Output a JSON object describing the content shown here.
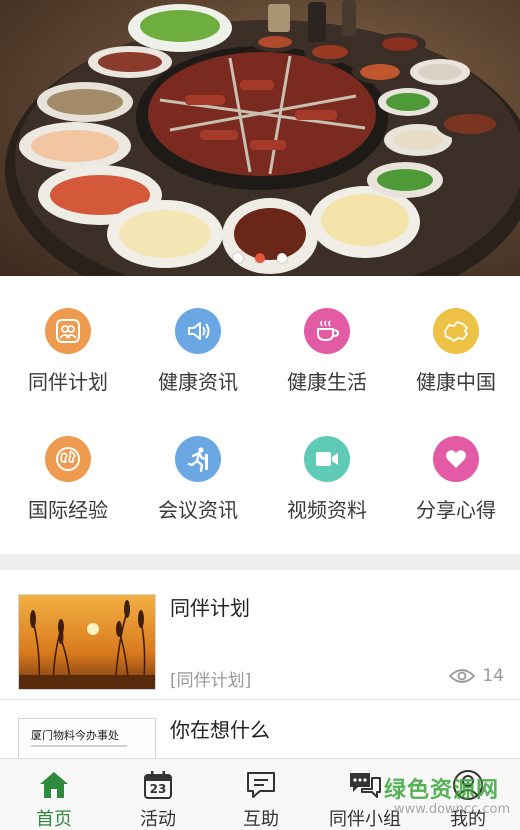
{
  "banner": {
    "slides": 3,
    "active_slide": 2,
    "image": "hotpot-photo"
  },
  "features": [
    {
      "label": "同伴计划",
      "icon": "people-icon",
      "color": "#ee9a4f"
    },
    {
      "label": "健康资讯",
      "icon": "speaker-icon",
      "color": "#6aa7e3"
    },
    {
      "label": "健康生活",
      "icon": "coffee-icon",
      "color": "#e35aa5"
    },
    {
      "label": "健康中国",
      "icon": "china-map-icon",
      "color": "#eec245"
    },
    {
      "label": "国际经验",
      "icon": "globe-icon",
      "color": "#ee9a4f"
    },
    {
      "label": "会议资讯",
      "icon": "runner-icon",
      "color": "#6aa7e3"
    },
    {
      "label": "视频资料",
      "icon": "video-camera-icon",
      "color": "#5fcbb6"
    },
    {
      "label": "分享心得",
      "icon": "heart-icon",
      "color": "#e35aa5"
    }
  ],
  "articles": [
    {
      "title": "同伴计划",
      "category": "[同伴计划]",
      "views": "14",
      "thumb": "sunset-reeds-photo"
    },
    {
      "title": "你在想什么",
      "thumb_text": "厦门物料今办事处",
      "thumb": "document-photo"
    }
  ],
  "tabs": [
    {
      "label": "首页",
      "icon": "home-icon",
      "active": true
    },
    {
      "label": "活动",
      "icon": "calendar-icon",
      "calendar_day": "23"
    },
    {
      "label": "互助",
      "icon": "chat-icon"
    },
    {
      "label": "同伴小组",
      "icon": "group-chat-icon"
    },
    {
      "label": "我的",
      "icon": "user-icon"
    }
  ],
  "colors": {
    "accent": "#2e8b3e",
    "active_dot": "#e2573b"
  },
  "watermark": {
    "main": "绿色资源网",
    "sub": "www.downcc.com"
  }
}
